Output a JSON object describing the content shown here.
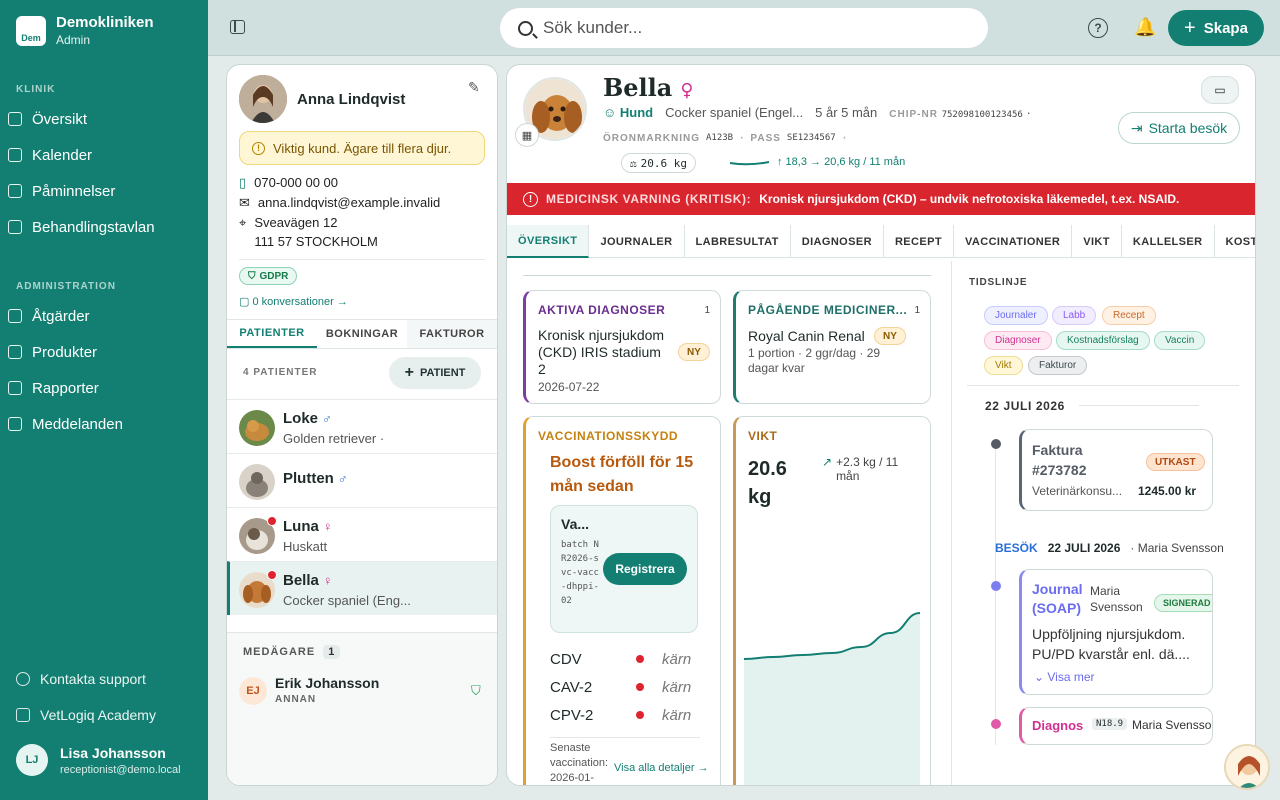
{
  "org": {
    "name": "Demokliniken",
    "role": "Admin",
    "logo_text": "Dem"
  },
  "nav": {
    "klinik_label": "KLINIK",
    "admin_label": "ADMINISTRATION",
    "items": [
      "Översikt",
      "Kalender",
      "Påminnelser",
      "Behandlingstavlan"
    ],
    "admin_items": [
      "Åtgärder",
      "Produkter",
      "Rapporter",
      "Meddelanden"
    ],
    "support": "Kontakta support",
    "academy": "VetLogiq Academy"
  },
  "user": {
    "initials": "LJ",
    "name": "Lisa Johansson",
    "email": "receptionist@demo.local"
  },
  "topbar": {
    "search_placeholder": "Sök kunder...",
    "help": "?",
    "create_label": "Skapa"
  },
  "owner": {
    "name": "Anna Lindqvist",
    "warning": "Viktig kund. Ägare till flera djur.",
    "phone": "070-000 00 00",
    "email": "anna.lindqvist@example.invalid",
    "street": "Sveavägen 12",
    "city": "111 57 STOCKHOLM",
    "gdpr": "GDPR",
    "conversations": "0 konversationer →",
    "tabs": [
      "PATIENTER",
      "BOKNINGAR",
      "FAKTUROR"
    ],
    "patient_count": "4 PATIENTER",
    "add_patient": "PATIENT",
    "patients": [
      {
        "name": "Loke",
        "sex": "♂",
        "breed": "Golden retriever ·"
      },
      {
        "name": "Plutten",
        "sex": "♂",
        "breed": ""
      },
      {
        "name": "Luna",
        "sex": "♀",
        "breed": "Huskatt"
      },
      {
        "name": "Bella",
        "sex": "♀",
        "breed": "Cocker spaniel (Eng..."
      }
    ],
    "coowner_label": "MEDÄGARE",
    "coowner_count": "1",
    "coowner": {
      "initials": "EJ",
      "name": "Erik Johansson",
      "role": "ANNAN"
    }
  },
  "patient": {
    "name": "Bella",
    "sex": "♀",
    "species": "Hund",
    "breed": "Cocker spaniel (Engel...",
    "age": "5 år 5 mån",
    "chip_label": "CHIP-NR",
    "chip": "752098100123456",
    "ear_label": "ÖRONMARKNING",
    "ear": "A123B",
    "pass_label": "PASS",
    "pass": "SE1234567",
    "weight": "20.6 kg",
    "weight_trend": "↑ 18,3 → 20,6 kg / 11 mån",
    "start_visit": "Starta besök",
    "alert_label": "MEDICINSK VARNING (KRITISK):",
    "alert_text": "Kronisk njursjukdom (CKD) – undvik nefrotoxiska läkemedel, t.ex. NSAID."
  },
  "tabs": [
    "ÖVERSIKT",
    "JOURNALER",
    "LABRESULTAT",
    "DIAGNOSER",
    "RECEPT",
    "VACCINATIONER",
    "VIKT",
    "KALLELSER",
    "KOSTNADS"
  ],
  "diagnoses": {
    "title": "AKTIVA DIAGNOSER",
    "count": "1",
    "text": "Kronisk njursjukdom (CKD) IRIS stadium 2",
    "date": "2026-07-22",
    "badge": "NY"
  },
  "meds": {
    "title": "PÅGÅENDE MEDICINER...",
    "count": "1",
    "name": "Royal Canin Renal",
    "detail": "1 portion · 2 ggr/dag · 29 dagar kvar",
    "badge": "NY"
  },
  "vacc": {
    "title": "VACCINATIONSSKYDD",
    "overdue": "Boost förföll för 15 mån sedan",
    "box_title": "Va...",
    "batch": "batch NR2026-svc-vacc-dhppi-02",
    "register": "Registrera",
    "rows": [
      {
        "name": "CDV",
        "status": "kärn"
      },
      {
        "name": "CAV-2",
        "status": "kärn"
      },
      {
        "name": "CPV-2",
        "status": "kärn"
      }
    ],
    "latest": "Senaste vaccination: 2026-01-",
    "details": "Visa alla detaljer →"
  },
  "weight": {
    "title": "VIKT",
    "value": "20.6 kg",
    "delta": "+2.3 kg / 11 mån"
  },
  "timeline": {
    "title": "TIDSLINJE",
    "filters": [
      "Journaler",
      "Labb",
      "Recept",
      "Diagnoser",
      "Kostnadsförslag",
      "Vaccin",
      "Vikt",
      "Fakturor"
    ],
    "date1": "22 JULI 2026",
    "invoice": {
      "title": "Faktura #273782",
      "badge": "UTKAST",
      "desc": "Veterinärkonsu...",
      "amount": "1245.00 kr"
    },
    "visit_label": "BESÖK",
    "visit_date": "22 JULI 2026",
    "visit_vet": "· Maria Svensson",
    "journal": {
      "title": "Journal (SOAP)",
      "vet": "Maria Svensson",
      "badge": "SIGNERAD",
      "text": "Uppföljning njursjukdom. PU/PD kvarstår enl. dä....",
      "more": "Visa mer"
    },
    "diag": {
      "title": "Diagnos",
      "code": "N18.9",
      "vet": "Maria Svensson"
    }
  },
  "chart_data": {
    "type": "area",
    "title": "VIKT",
    "xlabel": "",
    "ylabel": "",
    "y": [
      18.3,
      18.4,
      18.5,
      18.6,
      18.9,
      19.6,
      20.6
    ]
  }
}
